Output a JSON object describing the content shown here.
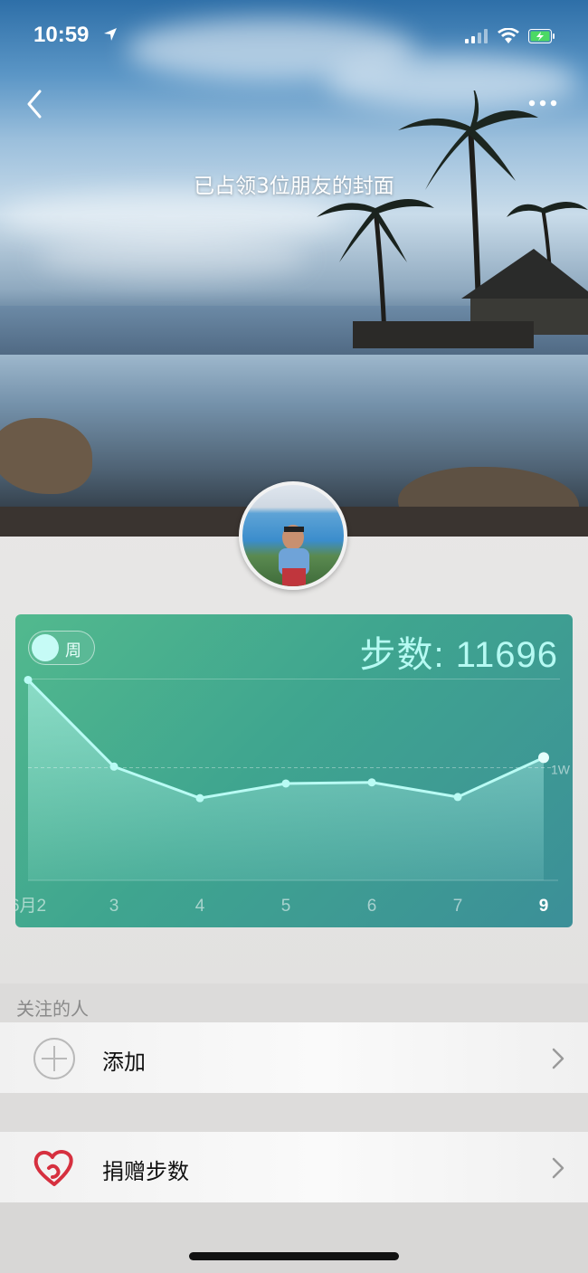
{
  "status_bar": {
    "time": "10:59"
  },
  "cover": {
    "title": "已占领3位朋友的封面"
  },
  "card": {
    "toggle_label": "周",
    "steps_text": "步数: 11696",
    "reference_label": "1W"
  },
  "chart_data": {
    "type": "area",
    "title": "",
    "x": [
      "6月2",
      "3",
      "4",
      "5",
      "6",
      "7",
      "9"
    ],
    "series": [
      {
        "values": [
          17800,
          10100,
          7300,
          8600,
          8700,
          7400,
          10900
        ]
      }
    ],
    "reference_line": {
      "value": 10000,
      "label": "1W"
    },
    "ylim": [
      0,
      18000
    ],
    "highlight_last": true
  },
  "sections": {
    "following_label": "关注的人",
    "add_label": "添加",
    "donate_label": "捐赠步数"
  },
  "colors": {
    "card_start": "#52b98e",
    "card_end": "#3c8f98",
    "line": "#b9fbf4",
    "donate_heart": "#d6303f"
  },
  "icons": {
    "back": "chevron-left-icon",
    "more": "more-dots-icon",
    "add": "plus-circle-icon",
    "donate": "heart-hands-icon",
    "chevron": "chevron-right-icon"
  }
}
